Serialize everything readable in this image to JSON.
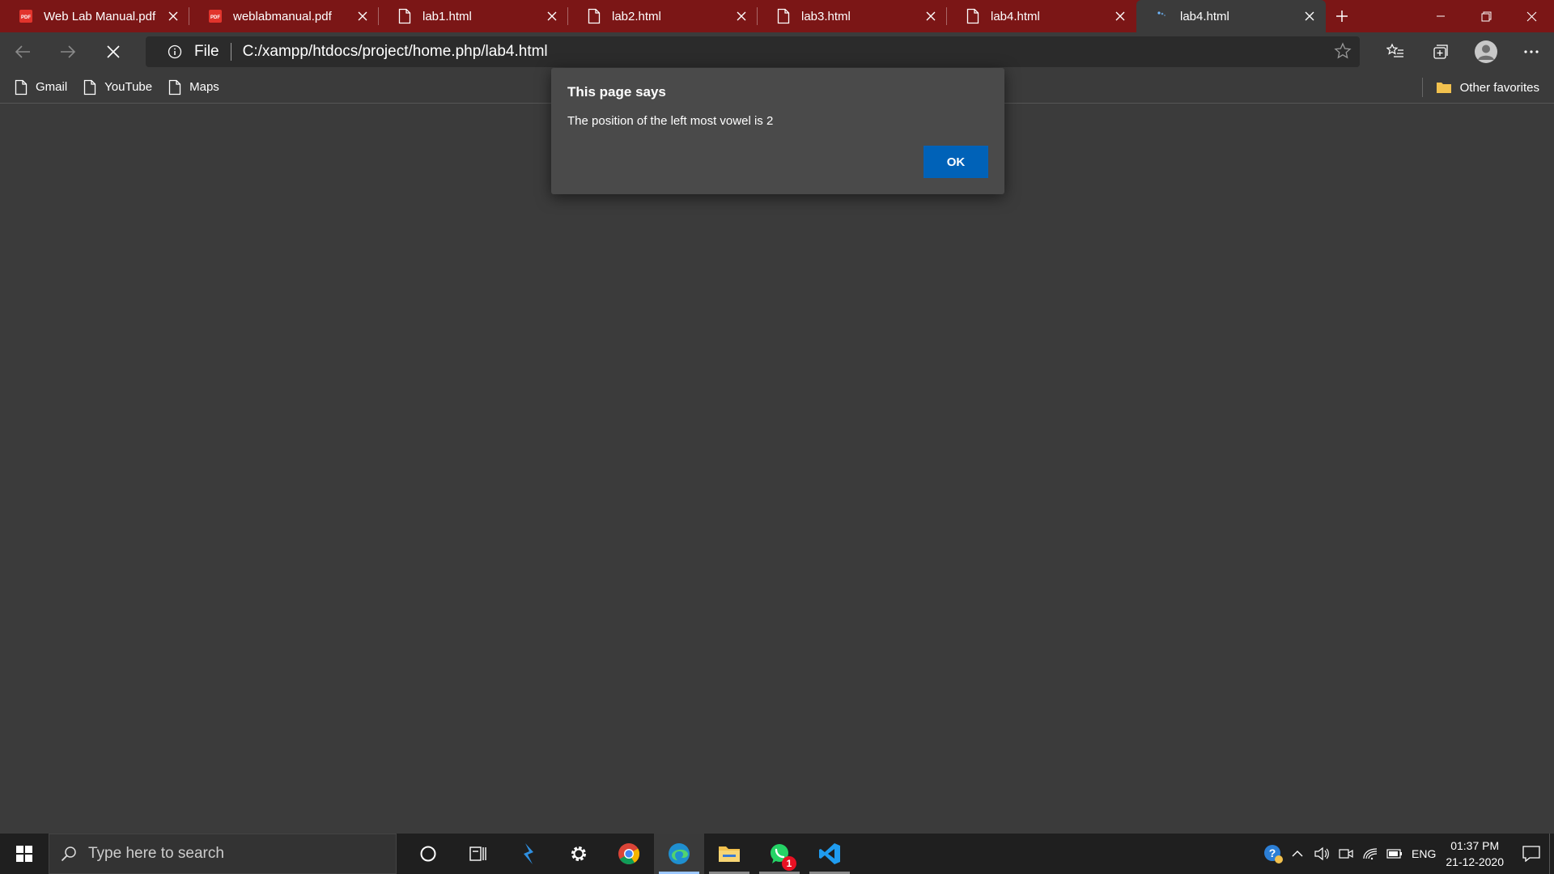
{
  "tabs": [
    {
      "label": "Web Lab Manual.pdf",
      "icon": "pdf-icon"
    },
    {
      "label": "weblabmanual.pdf",
      "icon": "pdf-icon"
    },
    {
      "label": "lab1.html",
      "icon": "page-icon"
    },
    {
      "label": "lab2.html",
      "icon": "page-icon"
    },
    {
      "label": "lab3.html",
      "icon": "page-icon"
    },
    {
      "label": "lab4.html",
      "icon": "page-icon"
    },
    {
      "label": "lab4.html",
      "icon": "loading-spinner-icon"
    }
  ],
  "address": {
    "scheme_label": "File",
    "url": "C:/xampp/htdocs/project/home.php/lab4.html"
  },
  "favorites": {
    "items": [
      {
        "label": "Gmail"
      },
      {
        "label": "YouTube"
      },
      {
        "label": "Maps"
      }
    ],
    "other_label": "Other favorites"
  },
  "dialog": {
    "title": "This page says",
    "message": "The position of the left most vowel is 2",
    "ok_label": "OK"
  },
  "taskbar": {
    "search_placeholder": "Type here to search",
    "whatsapp_badge": "1",
    "language": "ENG",
    "time": "01:37 PM",
    "date": "21-12-2020"
  },
  "colors": {
    "tabstrip": "#7b1616",
    "page_background": "#3b3b3b",
    "dialog_background": "#4a4a4a",
    "ok_button": "#0062b8",
    "taskbar": "#1f1f1f"
  }
}
